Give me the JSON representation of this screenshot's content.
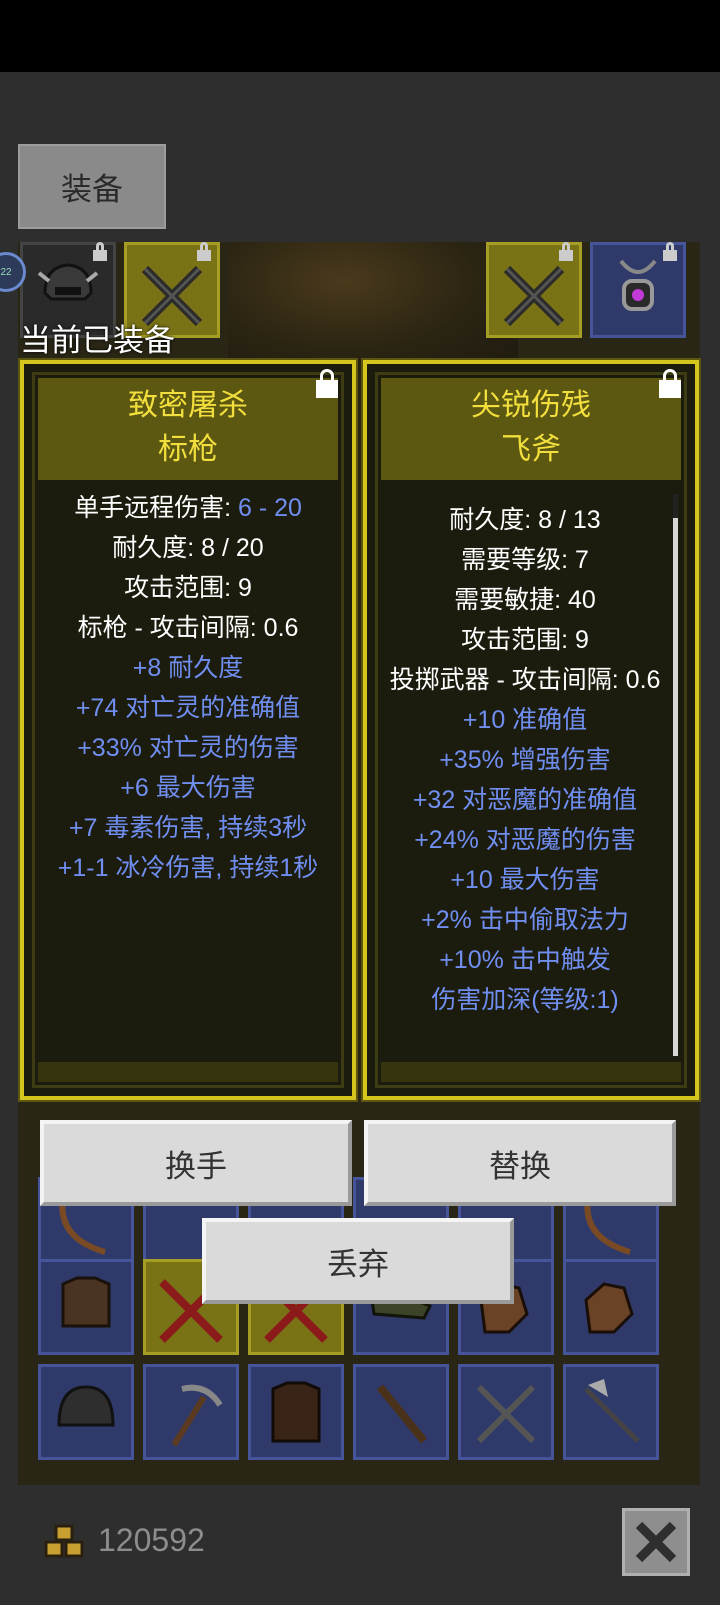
{
  "tab": {
    "label": "装备"
  },
  "equipped_label": "当前已装备",
  "avatar_badge": "22",
  "panel_left": {
    "name_line1": "致密屠杀",
    "name_line2": "标枪",
    "stats": {
      "damage_label": "单手远程伤害: ",
      "damage_value": "6 - 20",
      "durability": "耐久度: 8 / 20",
      "range": "攻击范围: 9",
      "interval": "标枪 - 攻击间隔: 0.6"
    },
    "affixes": [
      "+8 耐久度",
      "+74 对亡灵的准确值",
      "+33% 对亡灵的伤害",
      "+6 最大伤害",
      "+7 毒素伤害, 持续3秒",
      "+1-1 冰冷伤害, 持续1秒"
    ]
  },
  "panel_right": {
    "name_line1": "尖锐伤残",
    "name_line2": "飞斧",
    "stats": [
      "耐久度: 8 / 13",
      "需要等级: 7",
      "需要敏捷: 40",
      "攻击范围: 9",
      "投掷武器 - 攻击间隔: 0.6"
    ],
    "affixes": [
      "+10 准确值",
      "+35% 增强伤害",
      "+32 对恶魔的准确值",
      "+24% 对恶魔的伤害",
      "+10 最大伤害",
      "+2% 击中偷取法力",
      "+10% 击中触发",
      "伤害加深(等级:1)"
    ]
  },
  "buttons": {
    "swap_hands": "换手",
    "replace": "替换",
    "discard": "丢弃"
  },
  "gold": {
    "amount": "120592"
  },
  "colors": {
    "panel_border": "#d4c61c",
    "item_name": "#f2de3c",
    "affix_blue": "#6f8ef0",
    "slot_blue": "#2f3a6a",
    "slot_yellow": "#7a7316"
  }
}
